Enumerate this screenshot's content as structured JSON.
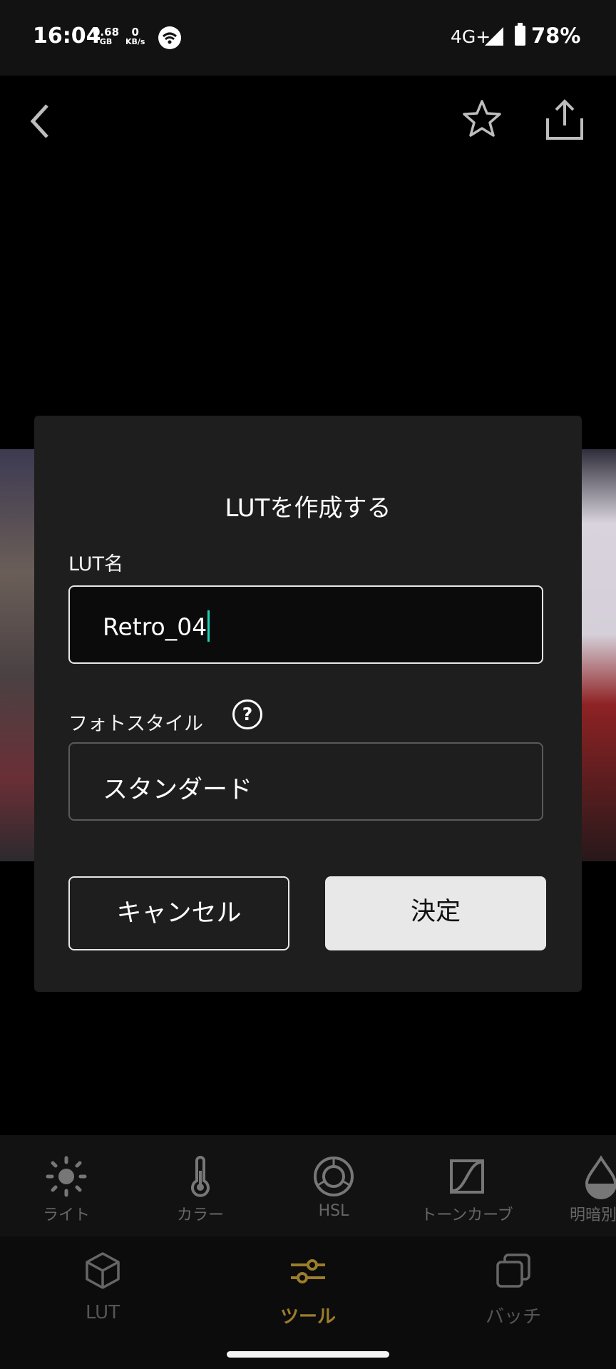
{
  "status_bar": {
    "time": "16:04",
    "data_used": "0.68",
    "data_used_unit": "GB",
    "speed": "0",
    "speed_unit": "KB/s",
    "network": "4G+",
    "battery": "78%"
  },
  "toolbar": {
    "back_icon": "chevron-left-icon",
    "favorite_icon": "star-icon",
    "share_icon": "share-icon"
  },
  "dialog": {
    "title": "LUTを作成する",
    "name_label": "LUT名",
    "name_value": "Retro_04",
    "style_label": "フォトスタイル",
    "help_glyph": "?",
    "style_value": "スタンダード",
    "cancel_label": "キャンセル",
    "confirm_label": "決定"
  },
  "tools": [
    {
      "label": "ライト",
      "icon": "sun-icon"
    },
    {
      "label": "カラー",
      "icon": "thermometer-icon"
    },
    {
      "label": "HSL",
      "icon": "hsl-ring-icon"
    },
    {
      "label": "トーンカーブ",
      "icon": "tone-curve-icon"
    },
    {
      "label": "明暗別色",
      "icon": "drop-icon"
    }
  ],
  "nav": {
    "items": [
      {
        "label": "LUT",
        "icon": "cube-icon"
      },
      {
        "label": "ツール",
        "icon": "sliders-icon"
      },
      {
        "label": "バッチ",
        "icon": "stack-icon"
      }
    ],
    "active": "ツール",
    "active_color": "#9c7d2a"
  }
}
